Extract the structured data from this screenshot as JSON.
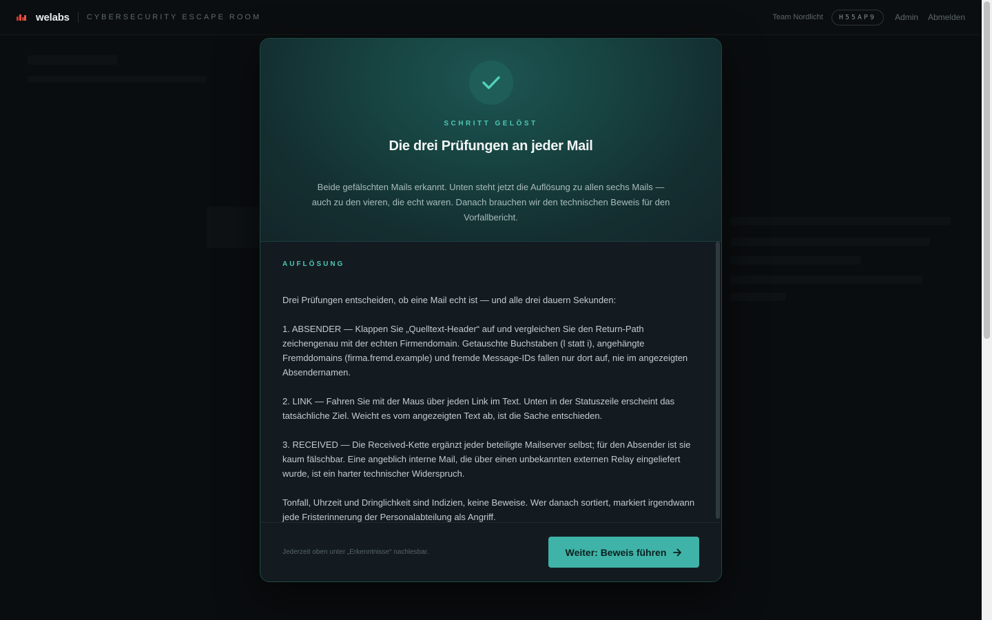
{
  "header": {
    "brand": "welabs",
    "subtitle": "Cybersecurity Escape Room",
    "team": "Team Nordlicht",
    "code": "H55AP9",
    "nav": [
      "Admin",
      "Abmelden"
    ]
  },
  "modal": {
    "kicker": "Schritt gelöst",
    "title": "Die drei Prüfungen an jeder Mail",
    "lead": "Beide gefälschten Mails erkannt. Unten steht jetzt die Auflösung zu allen sechs Mails — auch zu den vieren, die echt waren. Danach brauchen wir den technischen Beweis für den Vorfallbericht.",
    "section_label": "Auflösung",
    "paragraphs": [
      "Drei Prüfungen entscheiden, ob eine Mail echt ist — und alle drei dauern Sekunden:",
      "1. ABSENDER — Klappen Sie „Quelltext-Header“ auf und vergleichen Sie den Return-Path zeichengenau mit der echten Firmendomain. Getauschte Buchstaben (l statt i), angehängte Fremddomains (firma.fremd.example) und fremde Message-IDs fallen nur dort auf, nie im angezeigten Absendernamen.",
      "2. LINK — Fahren Sie mit der Maus über jeden Link im Text. Unten in der Statuszeile erscheint das tatsächliche Ziel. Weicht es vom angezeigten Text ab, ist die Sache entschieden.",
      "3. RECEIVED — Die Received-Kette ergänzt jeder beteiligte Mailserver selbst; für den Absender ist sie kaum fälschbar. Eine angeblich interne Mail, die über einen unbekannten externen Relay eingeliefert wurde, ist ein harter technischer Widerspruch.",
      "Tonfall, Uhrzeit und Dringlichkeit sind Indizien, keine Beweise. Wer danach sortiert, markiert irgendwann jede Fristerinnerung der Personalabteilung als Angriff."
    ],
    "footer_note": "Jederzeit oben unter „Erkenntnisse“ nachlesbar.",
    "cta_label": "Weiter: Beweis führen"
  },
  "colors": {
    "accent": "#4fc7b4",
    "button": "#3fb3a7",
    "logo": "#c0392b"
  },
  "icons": {
    "check": "check-icon",
    "arrow": "arrow-right-icon"
  }
}
